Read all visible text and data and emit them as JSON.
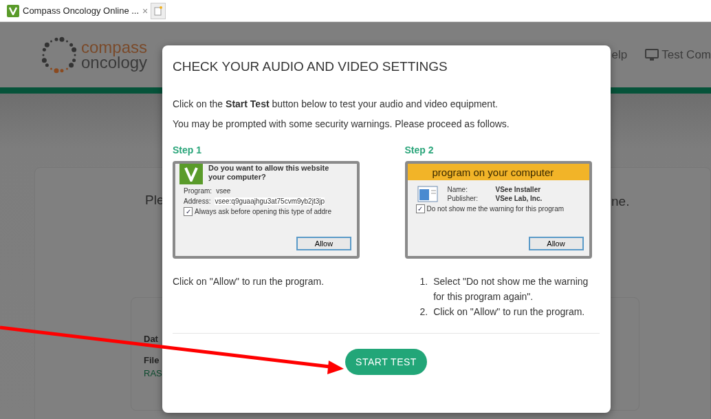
{
  "browser_tab": {
    "title": "Compass Oncology Online ...",
    "close": "×"
  },
  "header": {
    "logo_line_1": "compass",
    "logo_line_2": "oncology",
    "nav": [
      {
        "label": "elp"
      },
      {
        "label": "Test Com"
      }
    ]
  },
  "background": {
    "card_text_left": "Ple",
    "card_text_right": "ne.",
    "inner_labels": [
      "Dat",
      "File"
    ],
    "inner_link": "RAS"
  },
  "modal": {
    "title": "CHECK YOUR AUDIO AND VIDEO SETTINGS",
    "intro": "Click on the **Start Test** button below to test your audio and video equipment.",
    "note": "You may be prompted with some security warnings. Please proceed as follows.",
    "steps": [
      {
        "kind": "allow_site",
        "heading": "Step 1",
        "dialog": {
          "question_1": "Do you want to allow this website",
          "question_2": "your computer?",
          "fields": [
            {
              "label": "Program:",
              "value": "vsee"
            },
            {
              "label": "Address:",
              "value": "vsee:q9guaajhgu3at75cvm9yb2jt3jp"
            }
          ],
          "checkbox": {
            "label": "Always ask before opening this type of addre",
            "checked": true,
            "mark": "✓"
          },
          "button": "Allow"
        },
        "instructions": [
          "Click on \"Allow\" to run the program."
        ]
      },
      {
        "kind": "security_warning",
        "heading": "Step 2",
        "dialog": {
          "banner": "program on your computer",
          "fields": [
            {
              "label": "Name:",
              "value": "VSee Installer"
            },
            {
              "label": "Publisher:",
              "value": "VSee Lab, Inc."
            }
          ],
          "checkbox": {
            "label": "Do not show me the warning for this program",
            "checked": true,
            "mark": "✓"
          },
          "button": "Allow"
        },
        "instructions": [
          "Select \"Do not show me the warning for this program again\".",
          "Click on \"Allow\" to run the program."
        ],
        "numbers": [
          "1.",
          "2."
        ]
      }
    ],
    "button": "START TEST"
  }
}
